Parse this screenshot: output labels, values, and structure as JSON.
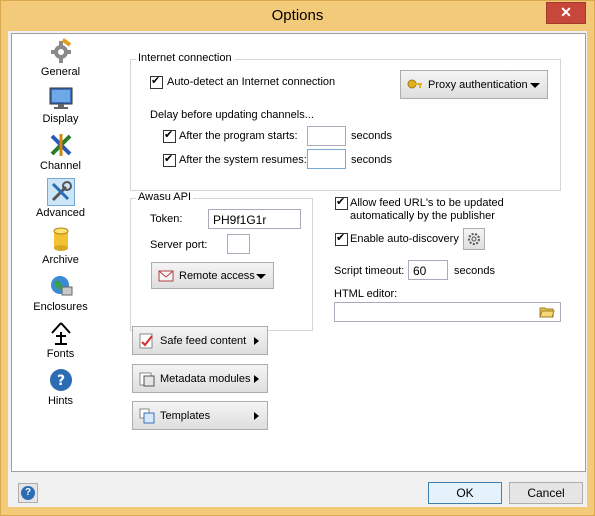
{
  "window": {
    "title": "Options",
    "close_glyph": "✕"
  },
  "sidebar": {
    "items": [
      {
        "label": "General",
        "icon": "gear-wrench-icon"
      },
      {
        "label": "Display",
        "icon": "monitor-icon"
      },
      {
        "label": "Channel",
        "icon": "channel-icon"
      },
      {
        "label": "Advanced",
        "icon": "tools-icon",
        "active": true
      },
      {
        "label": "Archive",
        "icon": "database-icon"
      },
      {
        "label": "Enclosures",
        "icon": "globe-icon"
      },
      {
        "label": "Fonts",
        "icon": "font-icon"
      },
      {
        "label": "Hints",
        "icon": "hints-icon"
      }
    ]
  },
  "internet": {
    "legend": "Internet connection",
    "auto_detect": {
      "label": "Auto-detect an Internet connection",
      "checked": true
    },
    "proxy_button": "Proxy authentication",
    "delay_label": "Delay before updating channels...",
    "after_start": {
      "label": "After the program starts:",
      "checked": true,
      "value": "",
      "unit": "seconds"
    },
    "after_resume": {
      "label": "After the system resumes:",
      "checked": true,
      "value": "",
      "unit": "seconds"
    }
  },
  "awasu_api": {
    "legend": "Awasu API",
    "token_label": "Token:",
    "token_value": "PH9f1G1r",
    "port_label": "Server port:",
    "port_value": "",
    "remote_button": "Remote access"
  },
  "feeds": {
    "allow_update": {
      "label_line1": "Allow feed URL's to be updated",
      "label_line2": "automatically by the publisher",
      "checked": true
    },
    "auto_discovery": {
      "label": "Enable auto-discovery",
      "checked": true
    },
    "script_timeout_label": "Script timeout:",
    "script_timeout_value": "60",
    "script_timeout_unit": "seconds",
    "html_editor_label": "HTML editor:",
    "html_editor_value": ""
  },
  "actions": {
    "safe_feed": "Safe feed content",
    "metadata": "Metadata modules",
    "templates": "Templates"
  },
  "footer": {
    "ok": "OK",
    "cancel": "Cancel"
  },
  "colors": {
    "frame": "#f3c97a",
    "accent": "#3c7fb1",
    "close": "#c7473a"
  }
}
